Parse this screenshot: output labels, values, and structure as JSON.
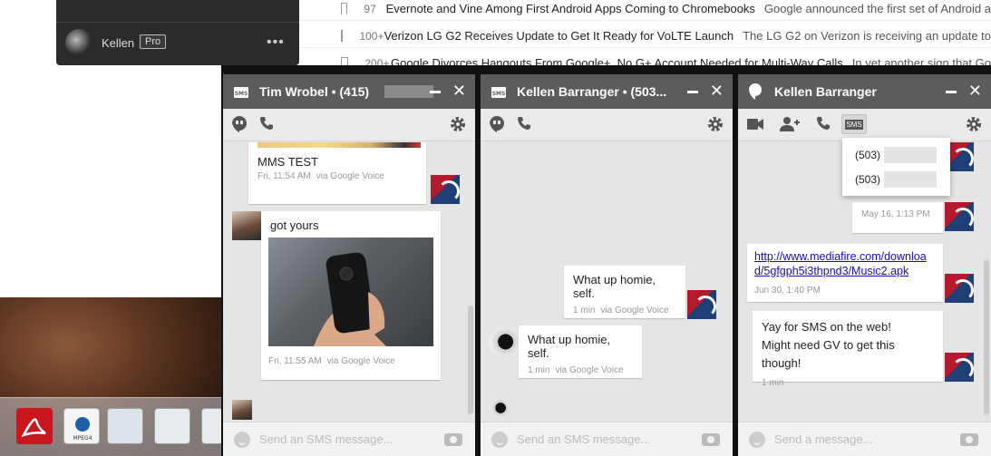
{
  "background_page": {
    "articles": [
      {
        "count": "97",
        "title": "Evernote and Vine Among First Android Apps Coming to Chromebooks",
        "snippet": "Google announced the first set of Android a"
      },
      {
        "count": "100+",
        "title": "Verizon LG G2 Receives Update to Get It Ready for VoLTE Launch",
        "snippet": "The LG G2 on Verizon is receiving an update to"
      },
      {
        "count": "200+",
        "title": "Google Divorces Hangouts From Google+, No G+ Account Needed for Multi-Way Calls",
        "snippet": "In yet another sign that Go"
      }
    ]
  },
  "hangouts_panel": {
    "user_name": "Kellen",
    "badge": "Pro",
    "more": "•••"
  },
  "chats": {
    "tim": {
      "title": "Tim Wrobel • (415)",
      "messages": [
        {
          "text": "MMS TEST",
          "time": "Fri, 11:54 AM",
          "via": "via Google Voice"
        },
        {
          "text": "got yours",
          "time": "Fri, 11:55 AM",
          "via": "via Google Voice"
        }
      ],
      "input_placeholder": "Send an SMS message..."
    },
    "kellen_sms": {
      "title": "Kellen Barranger • (503...",
      "messages": [
        {
          "text": "What up homie, self.",
          "time": "1 min",
          "via": "via Google Voice"
        },
        {
          "text": "What up homie, self.",
          "time": "1 min",
          "via": "via Google Voice"
        }
      ],
      "input_placeholder": "Send an SMS message..."
    },
    "kellen": {
      "title": "Kellen Barranger",
      "sms_button": "SMS",
      "dropdown": [
        "(503)",
        "(503)"
      ],
      "messages": [
        {
          "time": "May 16, 1:13 PM"
        },
        {
          "link": "http://www.mediafire.com/download/5gfgph5i3thpnd3/Music2.apk",
          "link_line1": "http://www.mediafire.com/downloa",
          "link_line2": "d/5gfgph5i3thpnd3/Music2.apk",
          "time": "Jun 30, 1:40 PM"
        },
        {
          "line1": "Yay for SMS on the web!",
          "line2": "Might need GV to get this though!",
          "time": "1 min"
        }
      ],
      "input_placeholder": "Send a message..."
    }
  },
  "colors": {
    "title_bar": "#5c5c5c",
    "chat_bg": "#e5e5e5",
    "link": "#1a0dab"
  }
}
